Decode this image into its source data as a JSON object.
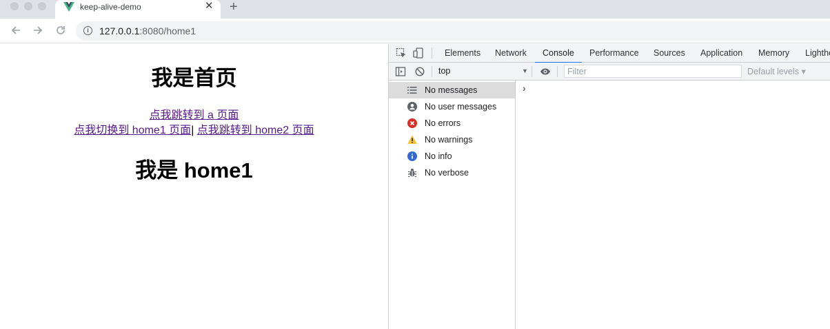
{
  "tab": {
    "title": "keep-alive-demo",
    "close": "✕",
    "new_tab": "+"
  },
  "address": {
    "host": "127.0.0.1",
    "path": ":8080/home1"
  },
  "page": {
    "heading": "我是首页",
    "link_a": "点我跳转到 a 页面",
    "link_home1": "点我切换到 home1 页面",
    "separator": "|",
    "link_home2": "点我跳转到 home2 页面",
    "subheading": "我是 home1"
  },
  "devtools": {
    "tabs": [
      "Elements",
      "Network",
      "Console",
      "Performance",
      "Sources",
      "Application",
      "Memory",
      "Lighthouse"
    ],
    "active_tab": "Console",
    "context": "top",
    "filter_placeholder": "Filter",
    "levels": "Default levels ▾",
    "sidebar": [
      {
        "label": "No messages",
        "icon": "list-icon"
      },
      {
        "label": "No user messages",
        "icon": "user-icon"
      },
      {
        "label": "No errors",
        "icon": "error-icon"
      },
      {
        "label": "No warnings",
        "icon": "warning-icon"
      },
      {
        "label": "No info",
        "icon": "info-icon"
      },
      {
        "label": "No verbose",
        "icon": "bug-icon"
      }
    ],
    "prompt": "›"
  },
  "colors": {
    "accent": "#1a73e8",
    "link_visited": "#551a8b",
    "error": "#d93025",
    "warning": "#f4c430",
    "info": "#3367d6"
  }
}
